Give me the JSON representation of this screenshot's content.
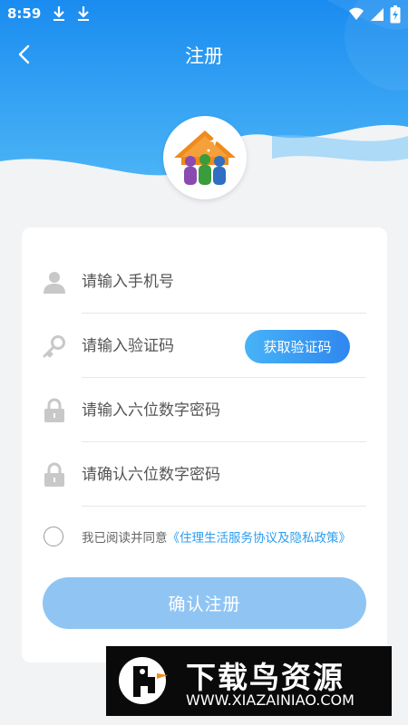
{
  "status_bar": {
    "time": "8:59"
  },
  "nav": {
    "title": "注册"
  },
  "form": {
    "phone_placeholder": "请输入手机号",
    "code_placeholder": "请输入验证码",
    "get_code_label": "获取验证码",
    "password_placeholder": "请输入六位数字密码",
    "confirm_placeholder": "请确认六位数字密码",
    "agreement_prefix": "我已阅读并同意",
    "agreement_link": "《住理生活服务协议及隐私政策》",
    "submit_label": "确认注册"
  },
  "watermark": {
    "text": "下载鸟资源",
    "url": "WWW.XIAZAINIAO.COM"
  },
  "colors": {
    "primary": "#2f9bf0",
    "header_top": "#1e8ff0",
    "link": "#2d9df0",
    "submit_disabled": "#90c5f3"
  }
}
